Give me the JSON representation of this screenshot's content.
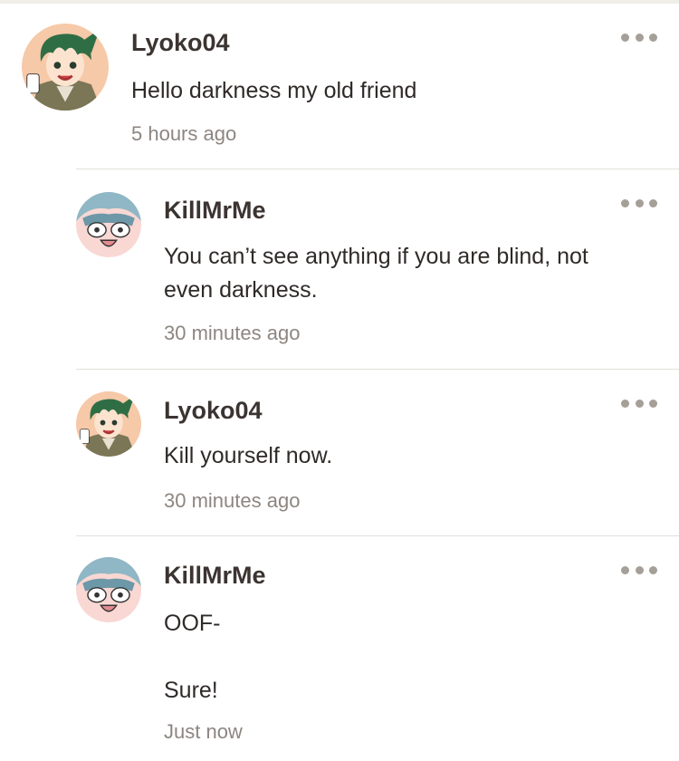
{
  "comments": [
    {
      "username": "Lyoko04",
      "text": "Hello darkness my old friend",
      "time": "5 hours ago",
      "avatar_icon": "anime-boy-green-hair-icon"
    },
    {
      "username": "KillMrMe",
      "text": "You can’t see anything if you are blind, not\neven darkness.",
      "time": "30 minutes ago",
      "avatar_icon": "anime-face-blue-hair-icon"
    },
    {
      "username": "Lyoko04",
      "text": "Kill yourself now.",
      "time": "30 minutes ago",
      "avatar_icon": "anime-boy-green-hair-icon"
    },
    {
      "username": "KillMrMe",
      "text": "OOF-\n\nSure!",
      "time": "Just now",
      "avatar_icon": "anime-face-blue-hair-icon"
    }
  ],
  "colors": {
    "username": "#3b3431",
    "text": "#2f2a28",
    "time": "#8d8680",
    "menu_dots": "#a59f98",
    "divider": "#e2e0dc"
  }
}
